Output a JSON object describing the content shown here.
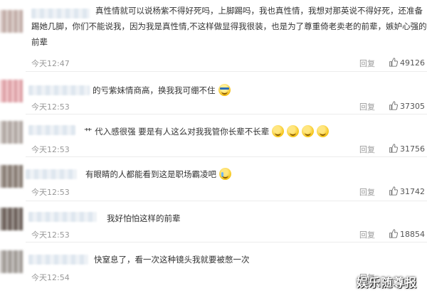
{
  "comments": [
    {
      "text": "真性情就可以说杨紫不得好死吗，上脚踢吗，我也真性情，我想对那英说不得好死，还准备踢她几脚，你们不能说我，因为我是真性情,不这样做显得我很装，也是为了尊重倚老卖老的前辈，嫉妒心强的前辈",
      "time": "今天12:47",
      "reply": "回复",
      "likes": "49126",
      "emojis": []
    },
    {
      "text": "的亏紫妹情商高，换我我可绷不住",
      "time": "今天12:53",
      "reply": "回复",
      "likes": "37305",
      "emojis": [
        "cool-face-emoji"
      ]
    },
    {
      "text": "代入感很强 要是有人这么对我我管你长辈不长辈",
      "prefix": "艹",
      "time": "今天12:53",
      "reply": "回复",
      "likes": "31756",
      "emojis": [
        "grin-emoji",
        "grin-emoji",
        "grin-emoji",
        "grin-emoji"
      ]
    },
    {
      "text": "有眼睛的人都能看到这是职场霸凌吧",
      "time": "今天12:53",
      "reply": "回复",
      "likes": "31742",
      "emojis": [
        "crying-face-emoji"
      ]
    },
    {
      "text": "我好怕怕这样的前辈",
      "time": "今天12:53",
      "reply": "回复",
      "likes": "18854",
      "emojis": []
    },
    {
      "text": "快窒息了，看一次这种镜头我就要被憋一次",
      "time": "今天12:54",
      "reply": "回复",
      "likes": "",
      "emojis": []
    }
  ],
  "watermark": "娱乐随尊报",
  "colors": {
    "text": "#333333",
    "meta": "#999999",
    "divider": "#ececec",
    "avatars": [
      "#c9b3ad",
      "#e8a7ad",
      "#b6aca6",
      "#8a7d74",
      "#6b5f58",
      "#a59f9a"
    ],
    "username_tints": [
      "#dfe7ef",
      "#e6ecf3",
      "#f1ebd6",
      "#e6ecf3",
      "#e8eef4",
      "#f1ebd6"
    ]
  },
  "icons": {
    "like": "thumbs-up-icon"
  }
}
